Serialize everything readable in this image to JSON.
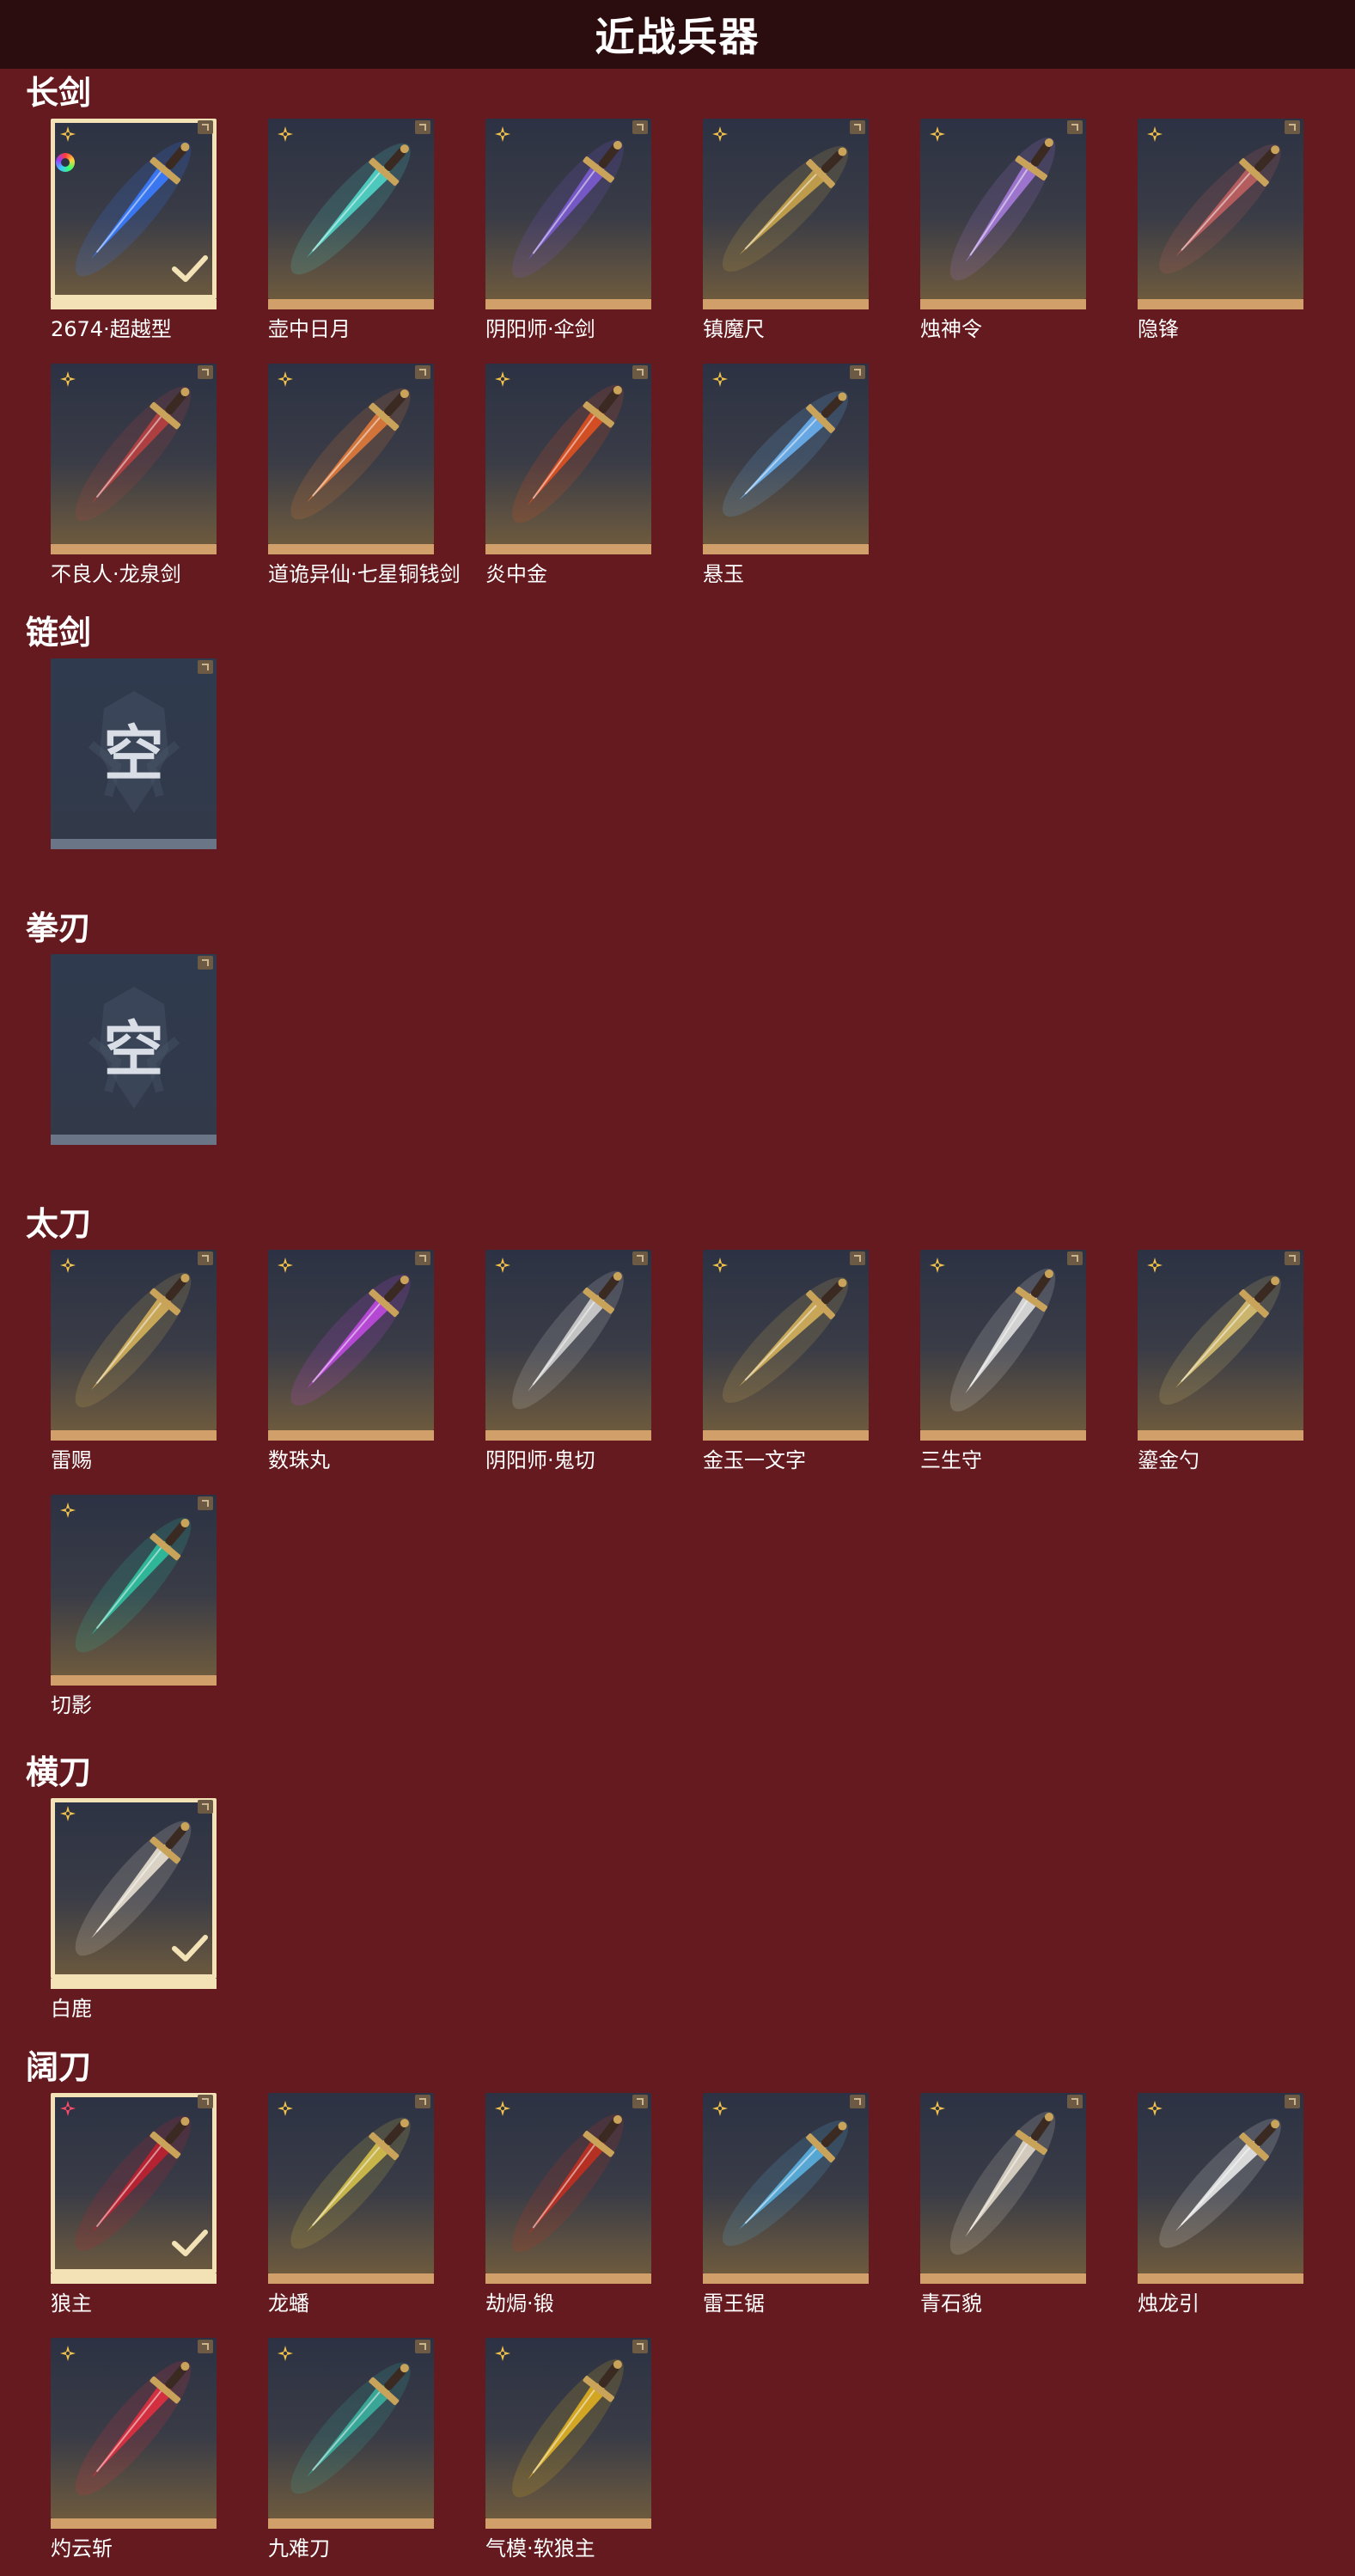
{
  "header": {
    "title": "近战兵器"
  },
  "colors": {
    "background": "#641a1e",
    "header": "#2c0d0f",
    "bar": "#d1a06a",
    "selected": "#f3e2b6"
  },
  "sections": [
    {
      "title": "长剑",
      "items": [
        {
          "label": "2674·超越型",
          "selected": true,
          "rarity": "gold",
          "tint": "#3a7cff"
        },
        {
          "label": "壶中日月",
          "rarity": "gold",
          "tint": "#4fd5c8"
        },
        {
          "label": "阴阳师·伞剑",
          "rarity": "gold",
          "tint": "#7b5bd0"
        },
        {
          "label": "镇魔尺",
          "rarity": "gold",
          "tint": "#c9a44a"
        },
        {
          "label": "烛神令",
          "rarity": "gold",
          "tint": "#a57ad9"
        },
        {
          "label": "隐锋",
          "rarity": "gold",
          "tint": "#c06060"
        },
        {
          "label": "不良人·龙泉剑",
          "rarity": "gold",
          "tint": "#b84040"
        },
        {
          "label": "道诡异仙·七星铜钱剑",
          "rarity": "gold",
          "tint": "#e07a3a"
        },
        {
          "label": "炎中金",
          "rarity": "gold",
          "tint": "#e05020"
        },
        {
          "label": "悬玉",
          "rarity": "gold",
          "tint": "#6ab0f0"
        }
      ]
    },
    {
      "title": "链剑",
      "items": [
        {
          "label": "",
          "empty": true,
          "empty_text": "空"
        }
      ]
    },
    {
      "title": "拳刃",
      "items": [
        {
          "label": "",
          "empty": true,
          "empty_text": "空"
        }
      ]
    },
    {
      "title": "太刀",
      "items": [
        {
          "label": "雷赐",
          "rarity": "gold",
          "tint": "#d4b05a"
        },
        {
          "label": "数珠丸",
          "rarity": "gold",
          "tint": "#c04ae0"
        },
        {
          "label": "阴阳师·鬼切",
          "rarity": "gold",
          "tint": "#d0d0d0"
        },
        {
          "label": "金玉一文字",
          "rarity": "gold",
          "tint": "#d4b05a"
        },
        {
          "label": "三生守",
          "rarity": "gold",
          "tint": "#e0e0e0"
        },
        {
          "label": "鎏金勺",
          "rarity": "gold",
          "tint": "#d8c070"
        },
        {
          "label": "切影",
          "rarity": "gold",
          "tint": "#2fc0a0"
        }
      ]
    },
    {
      "title": "横刀",
      "items": [
        {
          "label": "白鹿",
          "selected": true,
          "rarity": "gold",
          "tint": "#e8e0d0"
        }
      ]
    },
    {
      "title": "阔刀",
      "items": [
        {
          "label": "狼主",
          "selected": true,
          "rarity": "red",
          "tint": "#c02030"
        },
        {
          "label": "龙蟠",
          "rarity": "gold",
          "tint": "#d4c04a"
        },
        {
          "label": "劫焗·锻",
          "rarity": "gold",
          "tint": "#c03020"
        },
        {
          "label": "雷王锯",
          "rarity": "gold",
          "tint": "#5ab0e0"
        },
        {
          "label": "青石貌",
          "rarity": "gold",
          "tint": "#e0d8c8"
        },
        {
          "label": "烛龙引",
          "rarity": "gold",
          "tint": "#e8e8e8"
        },
        {
          "label": "灼云斩",
          "rarity": "gold",
          "tint": "#e03040"
        },
        {
          "label": "九难刀",
          "rarity": "gold",
          "tint": "#3ab0a0"
        },
        {
          "label": "气模·软狼主",
          "rarity": "gold",
          "tint": "#e0b020"
        }
      ]
    }
  ]
}
